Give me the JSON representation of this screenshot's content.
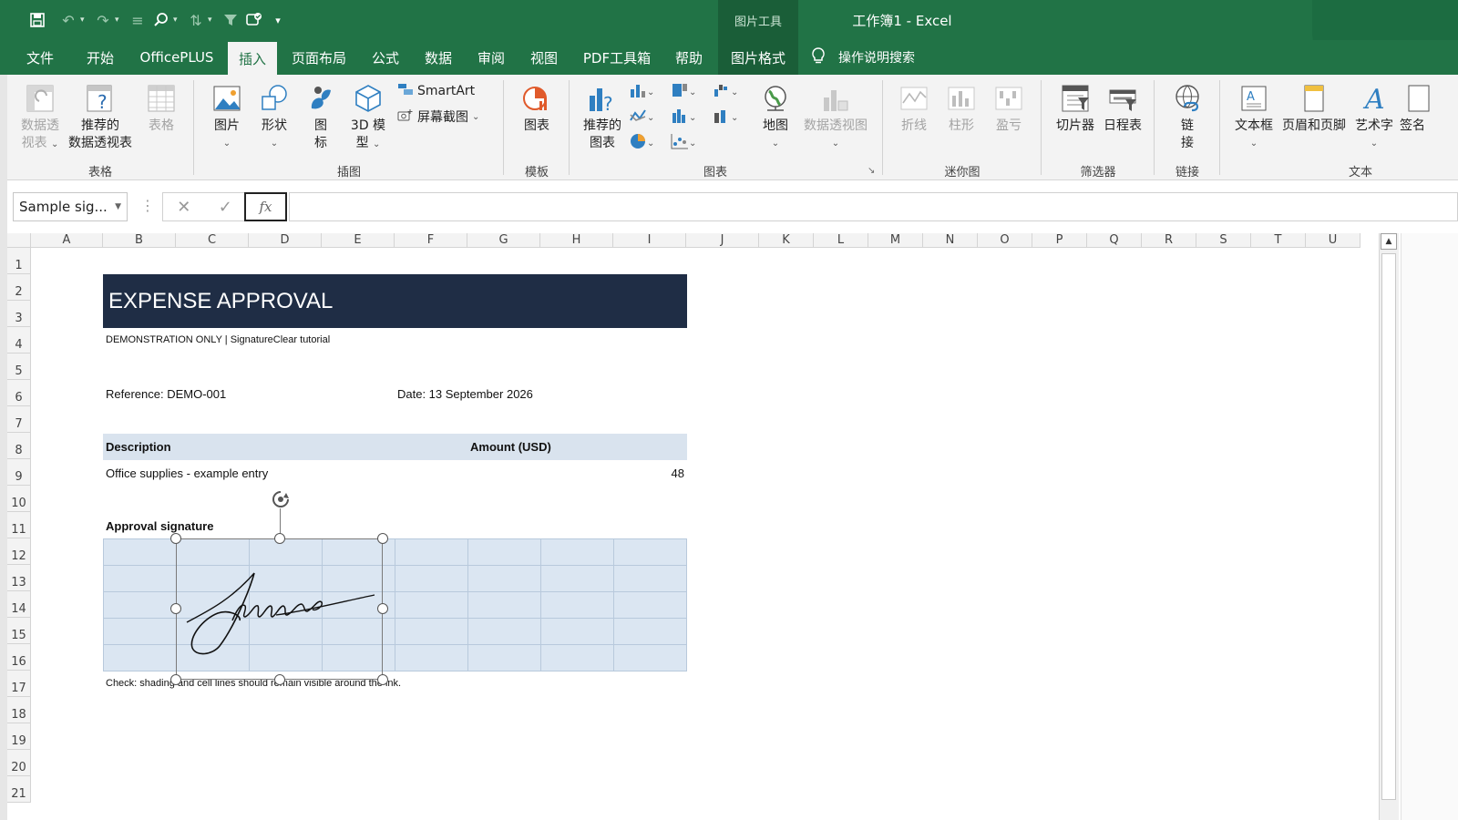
{
  "window": {
    "doc_title": "工作簿1  -  Excel",
    "context_tab_header": "图片工具"
  },
  "menu": {
    "tabs": [
      "文件",
      "开始",
      "OfficePLUS",
      "插入",
      "页面布局",
      "公式",
      "数据",
      "审阅",
      "视图",
      "PDF工具箱",
      "帮助",
      "图片格式"
    ],
    "active": "插入",
    "tell_me": "操作说明搜索"
  },
  "ribbon": {
    "groups": {
      "tables": "表格",
      "illustrations": "插图",
      "templates": "模板",
      "charts": "图表",
      "sparklines": "迷你图",
      "filters": "筛选器",
      "links": "链接",
      "text": "文本"
    },
    "items": {
      "pivot_table": [
        "数据透",
        "视表"
      ],
      "recommended_pivot": [
        "推荐的",
        "数据透视表"
      ],
      "table": "表格",
      "picture": "图片",
      "shapes": "形状",
      "icons": [
        "图",
        "标"
      ],
      "model3d": [
        "3D 模",
        "型"
      ],
      "smartart": "SmartArt",
      "screenshot": "屏幕截图",
      "chart_template": "图表",
      "recommended_charts": [
        "推荐的",
        "图表"
      ],
      "map": "地图",
      "pivot_chart": "数据透视图",
      "spark_line": "折线",
      "spark_column": "柱形",
      "spark_winloss": "盈亏",
      "slicer": "切片器",
      "timeline": "日程表",
      "link": [
        "链",
        "接"
      ],
      "textbox": "文本框",
      "header_footer": "页眉和页脚",
      "wordart": "艺术字",
      "signature": "签名"
    }
  },
  "formula_bar": {
    "name_box": "Sample sig...",
    "cancel": "✕",
    "enter": "✓",
    "fx": "fx",
    "value": ""
  },
  "columns": [
    "A",
    "B",
    "C",
    "D",
    "E",
    "F",
    "G",
    "H",
    "I",
    "J",
    "K",
    "L",
    "M",
    "N",
    "O",
    "P",
    "Q",
    "R",
    "S",
    "T",
    "U"
  ],
  "rows": [
    "1",
    "2",
    "3",
    "4",
    "5",
    "6",
    "7",
    "8",
    "9",
    "10",
    "11",
    "12",
    "13",
    "14",
    "15",
    "16",
    "17",
    "18",
    "19",
    "20",
    "21"
  ],
  "sheet": {
    "banner": "EXPENSE APPROVAL",
    "subtitle": "DEMONSTRATION ONLY | SignatureClear tutorial",
    "reference": "Reference: DEMO-001",
    "date": "Date: 13 September 2026",
    "table_head_desc": "Description",
    "table_head_amount": "Amount (USD)",
    "row_desc": "Office supplies - example entry",
    "row_amount": "48",
    "approval_label": "Approval signature",
    "check_note": "Check: shading and cell lines should remain visible around the ink.",
    "signature_ink": "James"
  },
  "colors": {
    "excel_green": "#217346",
    "banner_navy": "#1f2d45",
    "table_head_fill": "#d9e3ee",
    "sig_fill": "#dbe6f2"
  }
}
